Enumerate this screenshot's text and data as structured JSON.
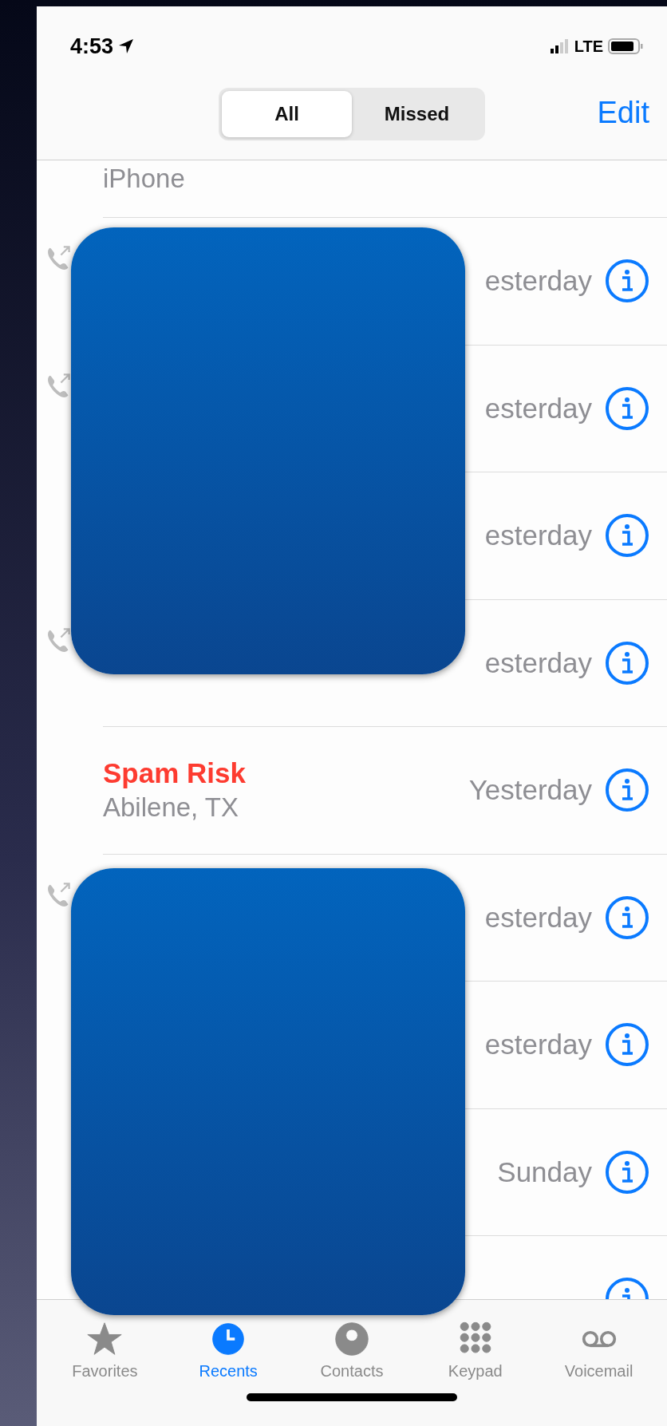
{
  "status_bar": {
    "time": "4:53",
    "network": "LTE"
  },
  "segments": [
    {
      "label": "All",
      "selected": true
    },
    {
      "label": "Missed",
      "selected": false
    }
  ],
  "edit": "Edit",
  "calls": [
    {
      "kind": "cut_top",
      "subtitle": "iPhone"
    },
    {
      "kind": "full",
      "outgoing": true,
      "time": "esterday"
    },
    {
      "kind": "full",
      "outgoing": true,
      "time": "esterday"
    },
    {
      "kind": "full",
      "outgoing": false,
      "time": "esterday"
    },
    {
      "kind": "full",
      "outgoing": true,
      "time": "esterday"
    },
    {
      "kind": "full",
      "outgoing": false,
      "spam": true,
      "name": "Spam Risk",
      "subtitle": "Abilene, TX",
      "time": "Yesterday"
    },
    {
      "kind": "full",
      "outgoing": true,
      "time": "esterday"
    },
    {
      "kind": "full",
      "outgoing": false,
      "time": "esterday"
    },
    {
      "kind": "full",
      "outgoing": false,
      "time": "Sunday"
    },
    {
      "kind": "cut_bottom"
    }
  ],
  "redactions": [
    {
      "kind": "block"
    },
    {
      "kind": "block"
    }
  ],
  "tabs": [
    {
      "label": "Favorites",
      "selected": false
    },
    {
      "label": "Recents",
      "selected": true
    },
    {
      "label": "Contacts",
      "selected": false
    },
    {
      "label": "Keypad",
      "selected": false
    },
    {
      "label": "Voicemail",
      "selected": false
    }
  ]
}
